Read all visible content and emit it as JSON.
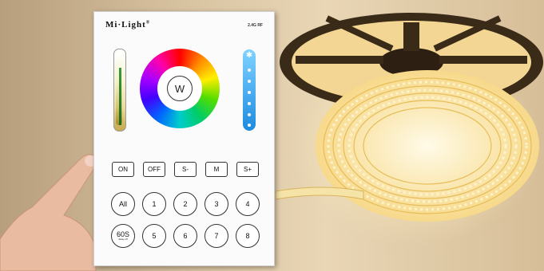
{
  "remote": {
    "brand": "Mi·Light",
    "reg_mark": "®",
    "rf_badge": "2.4G RF",
    "wheel_center": "W",
    "top_row": [
      "ON",
      "OFF",
      "S-",
      "M",
      "S+"
    ],
    "mid_row": [
      "All",
      "1",
      "2",
      "3",
      "4"
    ],
    "bottom_row": {
      "timer": "60S",
      "timer_sub": "delay off",
      "zones": [
        "5",
        "6",
        "7",
        "8"
      ]
    }
  },
  "colors": {
    "wheel": [
      "#ff0000",
      "#ffee00",
      "#00cc66",
      "#0066ff",
      "#aa00ff"
    ],
    "brightness_bar": "#1e8be0",
    "led_glow": "#ffe9a8"
  }
}
